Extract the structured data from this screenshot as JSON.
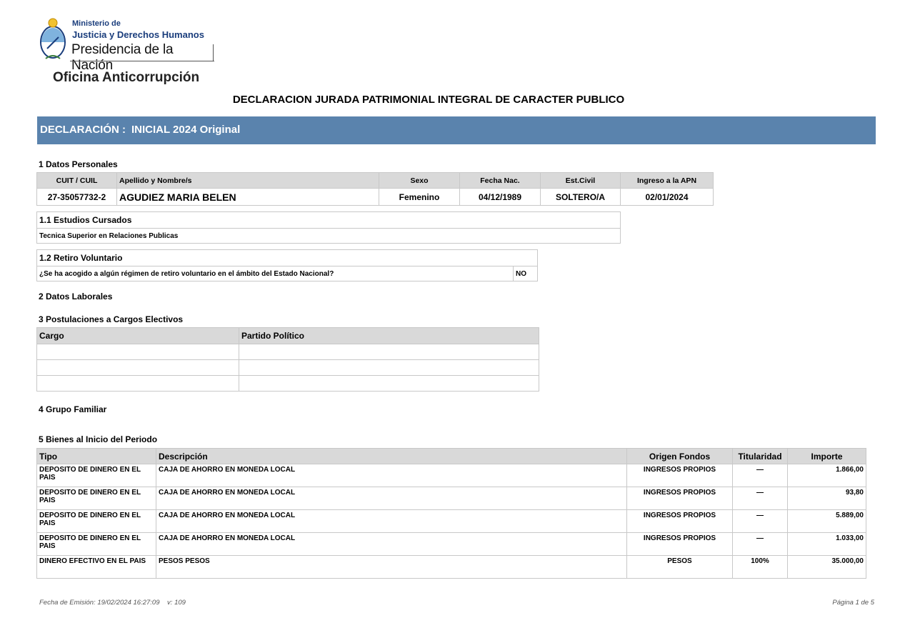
{
  "header": {
    "ministry_line1": "Ministerio de",
    "ministry_line2": "Justicia y Derechos Humanos",
    "ministry_line3": "Presidencia de la Nación",
    "office": "Oficina Anticorrupción",
    "title": "DECLARACION JURADA PATRIMONIAL INTEGRAL DE CARACTER PUBLICO"
  },
  "declaration": {
    "label": "DECLARACIÓN :",
    "value": "INICIAL 2024 Original"
  },
  "section1": {
    "title": "1 Datos Personales",
    "headers": [
      "CUIT / CUIL",
      "Apellido y Nombre/s",
      "Sexo",
      "Fecha Nac.",
      "Est.Civil",
      "Ingreso a la APN"
    ],
    "values": [
      "27-35057732-2",
      "AGUDIEZ MARIA BELEN",
      "Femenino",
      "04/12/1989",
      "SOLTERO/A",
      "02/01/2024"
    ]
  },
  "section1_1": {
    "title": "1.1 Estudios Cursados",
    "value": "Tecnica Superior en Relaciones Publicas"
  },
  "section1_2": {
    "title": "1.2 Retiro Voluntario",
    "question": "¿Se ha acogido a algún régimen de retiro voluntario en el ámbito del Estado Nacional?",
    "answer": "NO"
  },
  "section2": {
    "title": "2 Datos Laborales"
  },
  "section3": {
    "title": "3 Postulaciones a Cargos Electivos",
    "headers": [
      "Cargo",
      "Partido Político"
    ]
  },
  "section4": {
    "title": "4 Grupo Familiar"
  },
  "section5": {
    "title": "5 Bienes al Inicio del Periodo",
    "headers": [
      "Tipo",
      "Descripción",
      "Origen Fondos",
      "Titularidad",
      "Importe"
    ],
    "rows": [
      {
        "tipo": "DEPOSITO DE DINERO EN EL PAIS",
        "desc": "CAJA DE AHORRO EN MONEDA LOCAL",
        "origen": "INGRESOS PROPIOS",
        "tit": "—",
        "importe": "1.866,00"
      },
      {
        "tipo": "DEPOSITO DE DINERO EN EL PAIS",
        "desc": "CAJA DE AHORRO EN MONEDA LOCAL",
        "origen": "INGRESOS PROPIOS",
        "tit": "—",
        "importe": "93,80"
      },
      {
        "tipo": "DEPOSITO DE DINERO EN EL PAIS",
        "desc": "CAJA DE AHORRO EN MONEDA LOCAL",
        "origen": "INGRESOS PROPIOS",
        "tit": "—",
        "importe": "5.889,00"
      },
      {
        "tipo": "DEPOSITO DE DINERO EN EL PAIS",
        "desc": "CAJA DE AHORRO EN MONEDA LOCAL",
        "origen": "INGRESOS PROPIOS",
        "tit": "—",
        "importe": "1.033,00"
      },
      {
        "tipo": "DINERO EFECTIVO EN EL PAIS",
        "desc": "PESOS PESOS",
        "origen": "PESOS",
        "tit": "100%",
        "importe": "35.000,00"
      }
    ]
  },
  "footer": {
    "emission": "Fecha de Emisión: 19/02/2024 16:27:09",
    "version": "v: 109",
    "page": "Página 1 de 5"
  },
  "colors": {
    "declaration_bar": "#5a83ad",
    "table_header": "#d9d9d9",
    "ministry_text": "#1a3d7c"
  },
  "icons": {
    "logo": "escudo-nacional-icon"
  }
}
